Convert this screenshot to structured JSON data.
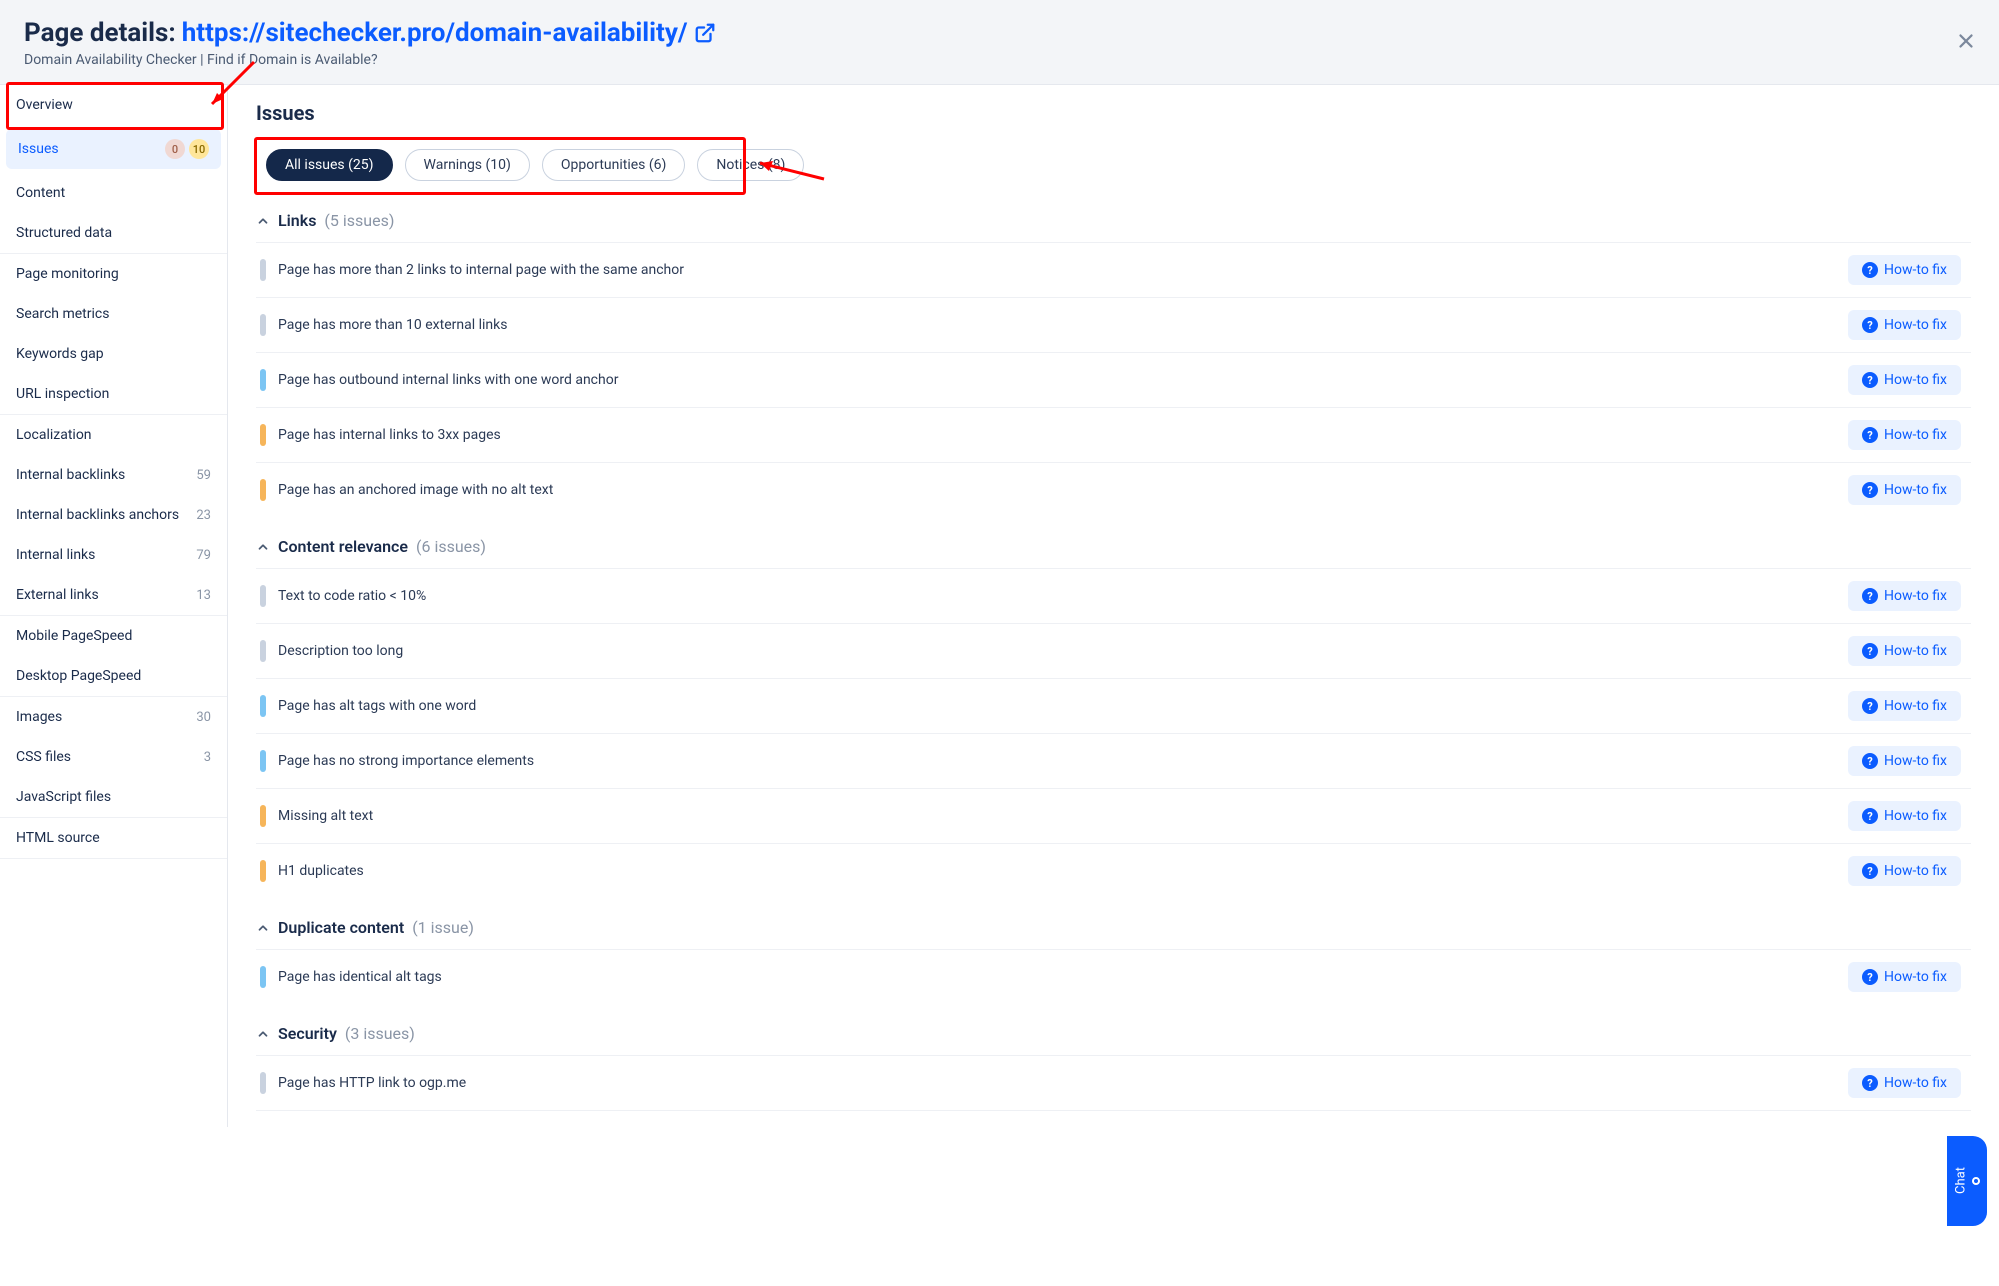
{
  "header": {
    "prefix": "Page details: ",
    "url": "https://sitechecker.pro/domain-availability/",
    "subtitle": "Domain Availability Checker | Find if Domain is Available?"
  },
  "sidebar": {
    "items": [
      {
        "label": "Overview"
      },
      {
        "label": "Issues",
        "active": true,
        "badge_a": "0",
        "badge_b": "10"
      },
      {
        "label": "Content"
      },
      {
        "label": "Structured data"
      },
      {
        "label": "Page monitoring",
        "sep": true
      },
      {
        "label": "Search metrics"
      },
      {
        "label": "Keywords gap"
      },
      {
        "label": "URL inspection"
      },
      {
        "label": "Localization",
        "sep": true
      },
      {
        "label": "Internal backlinks",
        "count": "59"
      },
      {
        "label": "Internal backlinks anchors",
        "count": "23"
      },
      {
        "label": "Internal links",
        "count": "79"
      },
      {
        "label": "External links",
        "count": "13"
      },
      {
        "label": "Mobile PageSpeed",
        "sep": true
      },
      {
        "label": "Desktop PageSpeed"
      },
      {
        "label": "Images",
        "count": "30",
        "sep": true
      },
      {
        "label": "CSS files",
        "count": "3"
      },
      {
        "label": "JavaScript files"
      },
      {
        "label": "HTML source",
        "sep": true
      }
    ]
  },
  "main": {
    "title": "Issues",
    "pills": [
      {
        "label": "All issues (25)",
        "active": true
      },
      {
        "label": "Warnings (10)"
      },
      {
        "label": "Opportunities (6)"
      },
      {
        "label": "Notices (8)"
      }
    ],
    "howto_label": "How-to fix",
    "groups": [
      {
        "title": "Links",
        "count": "(5 issues)",
        "issues": [
          {
            "sev": "grey",
            "text": "Page has more than 2 links to internal page with the same anchor"
          },
          {
            "sev": "grey",
            "text": "Page has more than 10 external links"
          },
          {
            "sev": "blue",
            "text": "Page has outbound internal links with one word anchor"
          },
          {
            "sev": "orange",
            "text": "Page has internal links to 3xx pages"
          },
          {
            "sev": "orange",
            "text": "Page has an anchored image with no alt text"
          }
        ]
      },
      {
        "title": "Content relevance",
        "count": "(6 issues)",
        "issues": [
          {
            "sev": "grey",
            "text": "Text to code ratio < 10%"
          },
          {
            "sev": "grey",
            "text": "Description too long"
          },
          {
            "sev": "blue",
            "text": "Page has alt tags with one word"
          },
          {
            "sev": "blue",
            "text": "Page has no strong importance elements"
          },
          {
            "sev": "orange",
            "text": "Missing alt text"
          },
          {
            "sev": "orange",
            "text": "H1 duplicates"
          }
        ]
      },
      {
        "title": "Duplicate content",
        "count": "(1 issue)",
        "issues": [
          {
            "sev": "blue",
            "text": "Page has identical alt tags"
          }
        ]
      },
      {
        "title": "Security",
        "count": "(3 issues)",
        "issues": [
          {
            "sev": "grey",
            "text": "Page has HTTP link to ogp.me"
          }
        ]
      }
    ]
  },
  "chat": {
    "label": "Chat"
  }
}
